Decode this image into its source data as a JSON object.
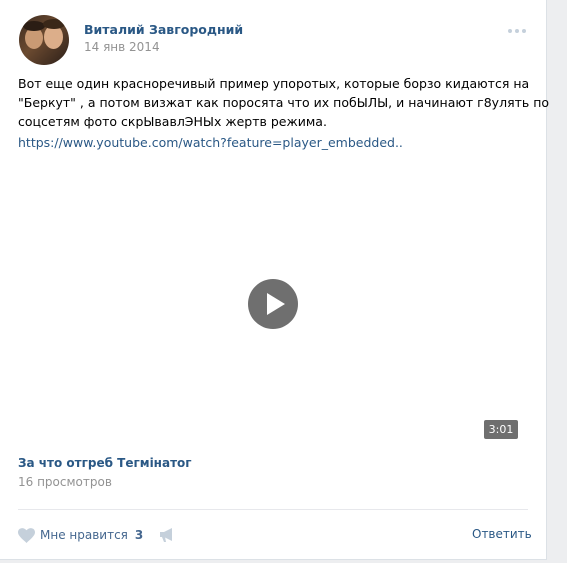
{
  "post": {
    "author": "Виталий Завгородний",
    "date": "14 янв 2014",
    "text_lines": [
      "Вот еще один красноречивый пример упоротых, которые борзо кидаются на",
      "\"Беркут\" , а потом визжат как поросята что их побЫЛЫ, и начинают г8улять по",
      "соцсетям фото скрЫвавлЭНЫх жертв режима."
    ],
    "link": "https://www.youtube.com/watch?feature=player_embedded..",
    "more_icon": "ellipsis-icon"
  },
  "video": {
    "duration": "3:01",
    "title": "За что отгреб Тегмінатог",
    "views": "16 просмотров",
    "play_icon": "play-icon",
    "overlay_color": "#6f6f6f"
  },
  "actions": {
    "like_label": "Мне нравится",
    "like_count": "3",
    "like_icon": "heart-icon",
    "share_icon": "megaphone-icon",
    "reply_label": "Ответить"
  },
  "colors": {
    "link": "#2a5885",
    "muted": "#939393",
    "background": "#edeef0",
    "card": "#ffffff"
  }
}
